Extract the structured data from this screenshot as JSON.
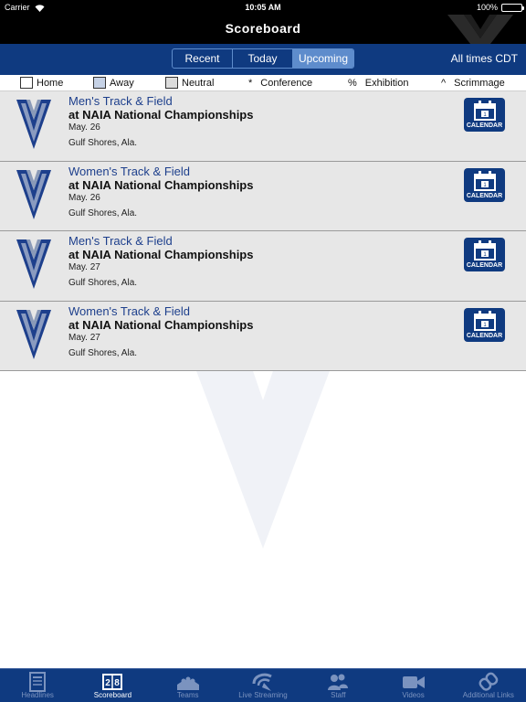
{
  "status_bar": {
    "carrier": "Carrier",
    "time": "10:05 AM",
    "battery": "100%"
  },
  "nav": {
    "title": "Scoreboard"
  },
  "segments": {
    "recent": "Recent",
    "today": "Today",
    "upcoming": "Upcoming",
    "active": "Upcoming"
  },
  "timezone": "All times CDT",
  "legend": {
    "home": "Home",
    "away": "Away",
    "neutral": "Neutral",
    "conference_symbol": "*",
    "conference": "Conference",
    "exhibition_symbol": "%",
    "exhibition": "Exhibition",
    "scrimmage_symbol": "^",
    "scrimmage": "Scrimmage"
  },
  "games": [
    {
      "sport": "Men's Track & Field",
      "event": "at NAIA National Championships",
      "date": "May. 26",
      "location": "Gulf Shores, Ala.",
      "calendar_label": "CALENDAR",
      "calendar_day": "1"
    },
    {
      "sport": "Women's Track & Field",
      "event": "at NAIA National Championships",
      "date": "May. 26",
      "location": "Gulf Shores, Ala.",
      "calendar_label": "CALENDAR",
      "calendar_day": "1"
    },
    {
      "sport": "Men's Track & Field",
      "event": "at NAIA National Championships",
      "date": "May. 27",
      "location": "Gulf Shores, Ala.",
      "calendar_label": "CALENDAR",
      "calendar_day": "1"
    },
    {
      "sport": "Women's Track & Field",
      "event": "at NAIA National Championships",
      "date": "May. 27",
      "location": "Gulf Shores, Ala.",
      "calendar_label": "CALENDAR",
      "calendar_day": "1"
    }
  ],
  "tabs": [
    {
      "label": "Headlines",
      "icon": "newspaper-icon"
    },
    {
      "label": "Scoreboard",
      "icon": "scoreboard-icon",
      "active": true
    },
    {
      "label": "Teams",
      "icon": "teams-icon"
    },
    {
      "label": "Live Streaming",
      "icon": "live-streaming-icon"
    },
    {
      "label": "Staff",
      "icon": "staff-icon"
    },
    {
      "label": "Videos",
      "icon": "video-camera-icon"
    },
    {
      "label": "Additional Links",
      "icon": "links-icon"
    }
  ],
  "colors": {
    "navy": "#0f3a80",
    "segment_active": "#5e8ccc",
    "row_background": "#e7e7e7",
    "sport_text": "#1d3f8c",
    "away_swatch": "#c6d2e6",
    "neutral_swatch": "#dcdcdc",
    "tab_inactive": "#7b93bf",
    "battery": "#4cd964"
  }
}
